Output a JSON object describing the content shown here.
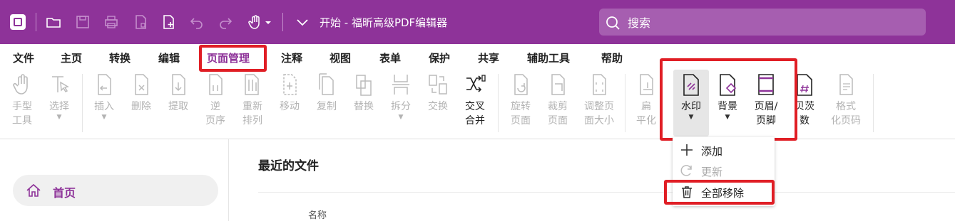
{
  "app": {
    "title": "开始 - 福昕高级PDF编辑器",
    "search_placeholder": "搜索",
    "brand_color": "#8e3399",
    "highlight_color": "#e01e25"
  },
  "menu": {
    "tabs": [
      "文件",
      "主页",
      "转换",
      "编辑",
      "页面管理",
      "注释",
      "视图",
      "表单",
      "保护",
      "共享",
      "辅助工具",
      "帮助"
    ],
    "active": "页面管理"
  },
  "toolbar": {
    "hand": "手型\n工具",
    "select": "选择",
    "insert": "插入",
    "delete": "删除",
    "extract": "提取",
    "reverse": "逆\n页序",
    "reorder": "重新\n排列",
    "move": "移动",
    "copy": "复制",
    "replace": "替换",
    "split": "拆分",
    "swap": "交换",
    "interleave": "交叉\n合并",
    "rotate": "旋转\n页面",
    "crop": "裁剪\n页面",
    "resize": "调整页\n面大小",
    "flatten": "扁\n平化",
    "watermark": "水印",
    "background": "背景",
    "header_footer": "页眉/\n页脚",
    "bates": "贝茨\n数",
    "format_page_num": "格式\n化页码"
  },
  "dropdown": {
    "add": "添加",
    "update": "更新",
    "remove_all": "全部移除"
  },
  "sidebar": {
    "home": "首页"
  },
  "main": {
    "recent_title": "最近的文件",
    "col_name": "名称"
  }
}
